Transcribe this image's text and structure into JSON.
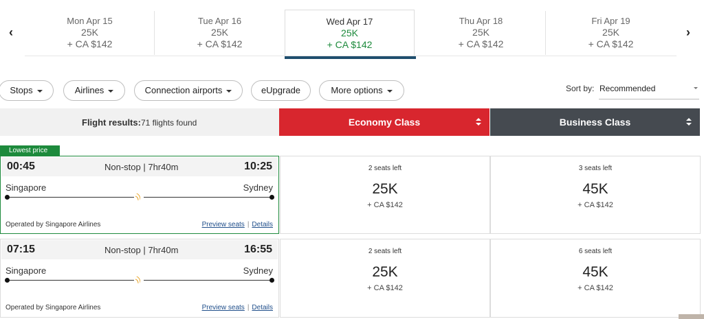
{
  "date_strip": {
    "prev_icon": "chevron-left",
    "next_icon": "chevron-right",
    "dates": [
      {
        "day": "Mon Apr 15",
        "miles": "25K",
        "tax": "+ CA $142",
        "selected": false
      },
      {
        "day": "Tue Apr 16",
        "miles": "25K",
        "tax": "+ CA $142",
        "selected": false
      },
      {
        "day": "Wed Apr 17",
        "miles": "25K",
        "tax": "+ CA $142",
        "selected": true
      },
      {
        "day": "Thu Apr 18",
        "miles": "25K",
        "tax": "+ CA $142",
        "selected": false
      },
      {
        "day": "Fri Apr 19",
        "miles": "25K",
        "tax": "+ CA $142",
        "selected": false
      }
    ]
  },
  "filters": {
    "stops": "Stops",
    "airlines": "Airlines",
    "connection_airports": "Connection airports",
    "eupgrade": "eUpgrade",
    "more_options": "More options"
  },
  "sort": {
    "label": "Sort by:",
    "value": "Recommended"
  },
  "results": {
    "label": "Flight results:",
    "count_text": "71 flights found"
  },
  "classes": {
    "economy": "Economy Class",
    "business": "Business Class"
  },
  "colors": {
    "economy": "#d8262e",
    "business": "#454a50",
    "selected_price": "#1d8a3c",
    "badge": "#1d8a3c",
    "selected_underline": "#1f4e6e"
  },
  "badge": "Lowest price",
  "flights": [
    {
      "depart": "00:45",
      "arrive": "10:25",
      "stops_duration": "Non-stop | 7hr40m",
      "from": "Singapore",
      "to": "Sydney",
      "operated_by": "Operated by Singapore Airlines",
      "preview": "Preview seats",
      "details": "Details",
      "economy": {
        "seats": "2 seats left",
        "miles": "25K",
        "tax": "+ CA $142"
      },
      "business": {
        "seats": "3 seats left",
        "miles": "45K",
        "tax": "+ CA $142"
      }
    },
    {
      "depart": "07:15",
      "arrive": "16:55",
      "stops_duration": "Non-stop | 7hr40m",
      "from": "Singapore",
      "to": "Sydney",
      "operated_by": "Operated by Singapore Airlines",
      "preview": "Preview seats",
      "details": "Details",
      "economy": {
        "seats": "2 seats left",
        "miles": "25K",
        "tax": "+ CA $142"
      },
      "business": {
        "seats": "6 seats left",
        "miles": "45K",
        "tax": "+ CA $142"
      }
    }
  ]
}
